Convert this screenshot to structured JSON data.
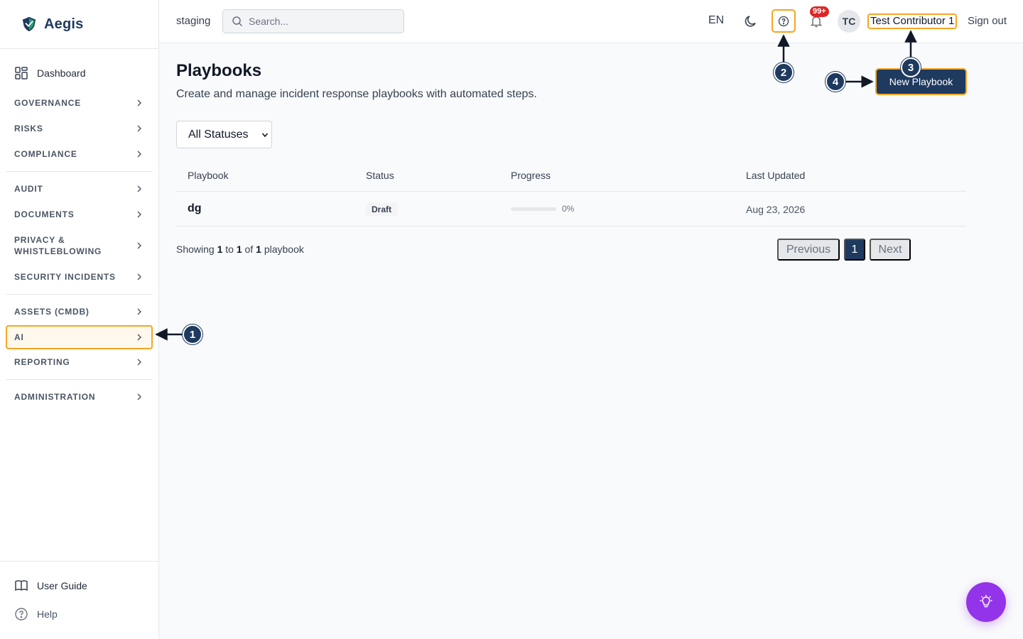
{
  "app": {
    "name": "Aegis",
    "environment": "staging"
  },
  "search": {
    "placeholder": "Search..."
  },
  "header": {
    "language": "EN",
    "notifications_badge": "99+",
    "avatar_initials": "TC",
    "user_name": "Test Contributor 1",
    "sign_out": "Sign out"
  },
  "sidebar": {
    "dashboard": "Dashboard",
    "groups": [
      [
        "GOVERNANCE",
        "RISKS",
        "COMPLIANCE"
      ],
      [
        "AUDIT",
        "DOCUMENTS",
        "PRIVACY & WHISTLEBLOWING",
        "SECURITY INCIDENTS"
      ],
      [
        "ASSETS (CMDB)",
        "AI",
        "REPORTING"
      ],
      [
        "ADMINISTRATION"
      ]
    ],
    "items": {
      "governance": "GOVERNANCE",
      "risks": "RISKS",
      "compliance": "COMPLIANCE",
      "audit": "AUDIT",
      "documents": "DOCUMENTS",
      "privacy": "PRIVACY & WHISTLEBLOWING",
      "security_incidents": "SECURITY INCIDENTS",
      "assets": "ASSETS (CMDB)",
      "ai": "AI",
      "reporting": "REPORTING",
      "administration": "ADMINISTRATION"
    },
    "user_guide": "User Guide",
    "help": "Help"
  },
  "page": {
    "title": "Playbooks",
    "subtitle": "Create and manage incident response playbooks with automated steps.",
    "new_button": "New Playbook",
    "filter": {
      "selected": "All Statuses"
    }
  },
  "table": {
    "columns": [
      "Playbook",
      "Status",
      "Progress",
      "Last Updated"
    ],
    "rows": [
      {
        "name": "dg",
        "status": "Draft",
        "progress_percent": 0,
        "progress_label": "0%",
        "last_updated": "Aug 23, 2026"
      }
    ]
  },
  "pagination": {
    "showing_prefix": "Showing",
    "from": "1",
    "to_word": "to",
    "to": "1",
    "of_word": "of",
    "total": "1",
    "unit": "playbook",
    "previous": "Previous",
    "current_page": "1",
    "next": "Next"
  },
  "annotations": [
    "1",
    "2",
    "3",
    "4"
  ],
  "colors": {
    "brand": "#1e3a5f",
    "highlight": "#f5a524",
    "badge": "#dc2626",
    "assistant": "#9333ea"
  }
}
